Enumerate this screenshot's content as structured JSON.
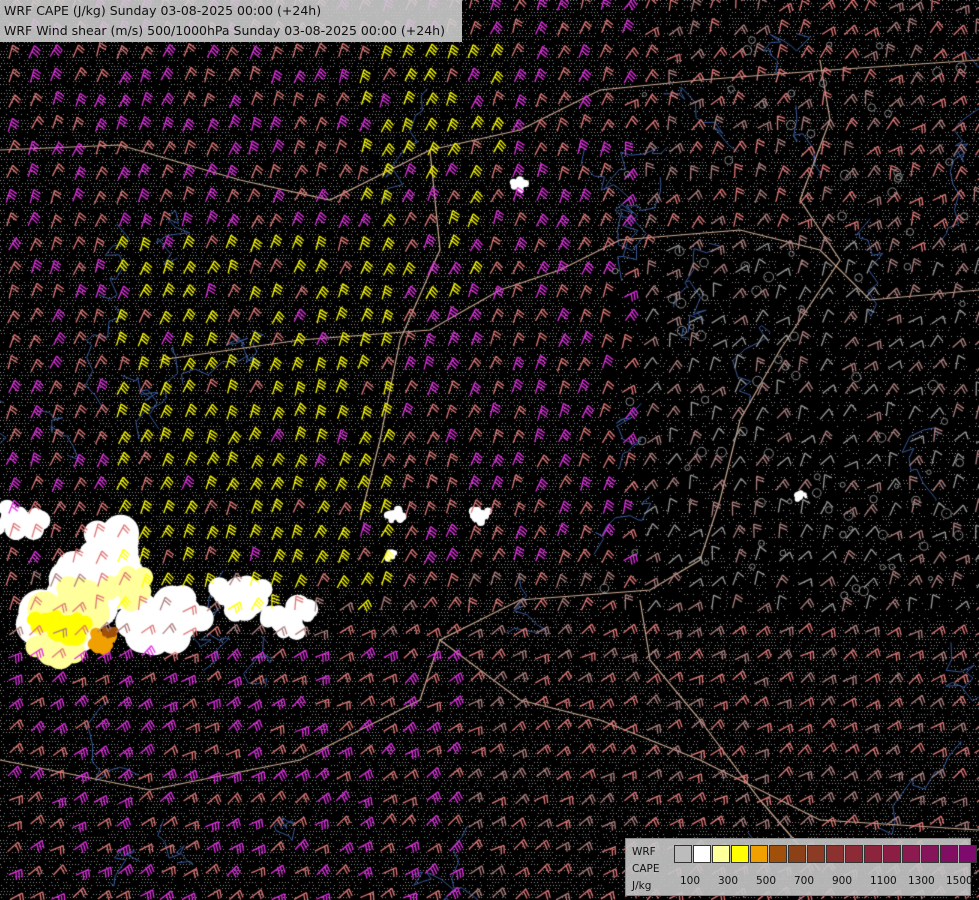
{
  "header": {
    "title_cape": "WRF CAPE (J/kg) Sunday 03-08-2025 00:00 (+24h)",
    "title_shear": "WRF Wind shear (m/s) 500/1000hPa Sunday 03-08-2025 00:00 (+24h)"
  },
  "legend": {
    "label_model": "WRF",
    "label_var": "CAPE",
    "label_unit": "J/kg",
    "ticks": [
      "100",
      "300",
      "500",
      "700",
      "900",
      "1100",
      "1300",
      "1500"
    ],
    "colors": [
      "#bcbcbc",
      "#ffffff",
      "#ffff9c",
      "#ffff00",
      "#f0a000",
      "#a0500a",
      "#8c4018",
      "#8c3c24",
      "#8c3030",
      "#8c2a36",
      "#8c243c",
      "#8c1e46",
      "#8a1a50",
      "#86145a",
      "#820e64",
      "#7e0a6e"
    ]
  },
  "map": {
    "background_color": "#000000",
    "stipple_color": "#8a8a8a",
    "border_color": "#c8a890",
    "river_color": "#3a5a9c",
    "cape_colors": [
      "#ffffff",
      "#ffff9c",
      "#ffff00",
      "#f0a000",
      "#a0500a"
    ],
    "barb_colors": {
      "weak": "#9a9a9a",
      "light": "#b08080",
      "moderate": "#e07878",
      "strong": "#e030e0",
      "very_strong": "#ffff00"
    }
  }
}
